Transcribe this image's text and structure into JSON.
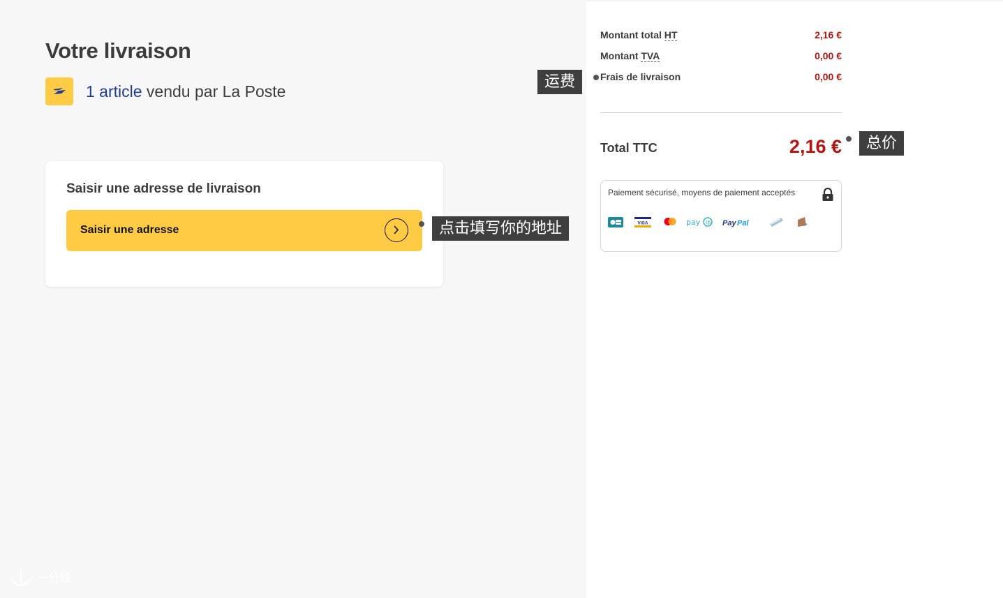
{
  "delivery": {
    "title": "Votre livraison",
    "seller_link": "1 article",
    "seller_rest": " vendu par La Poste",
    "card_title": "Saisir une adresse de livraison",
    "address_button_label": "Saisir une adresse"
  },
  "summary": {
    "rows": [
      {
        "prefix": "Montant total ",
        "abbr": "HT",
        "label": "",
        "value": "2,16 €"
      },
      {
        "prefix": "Montant ",
        "abbr": "TVA",
        "label": "",
        "value": "0,00 €"
      },
      {
        "prefix": "",
        "abbr": "",
        "label": "Frais de livraison",
        "value": "0,00 €"
      }
    ],
    "total_label": "Total TTC",
    "total_value": "2,16 €",
    "payment_text": "Paiement sécurisé, moyens de paiement acceptés",
    "payment_methods": [
      "CB",
      "VISA",
      "Mastercard",
      "payib",
      "PayPal",
      "Chèque",
      "Virement"
    ]
  },
  "annotations": {
    "shipping": "运费",
    "total": "总价",
    "address": "点击填写你的地址"
  },
  "watermark": "一分钱",
  "colors": {
    "accent_yellow": "#ffcb45",
    "price_red": "#b3170f",
    "link_blue": "#1e3c91"
  }
}
